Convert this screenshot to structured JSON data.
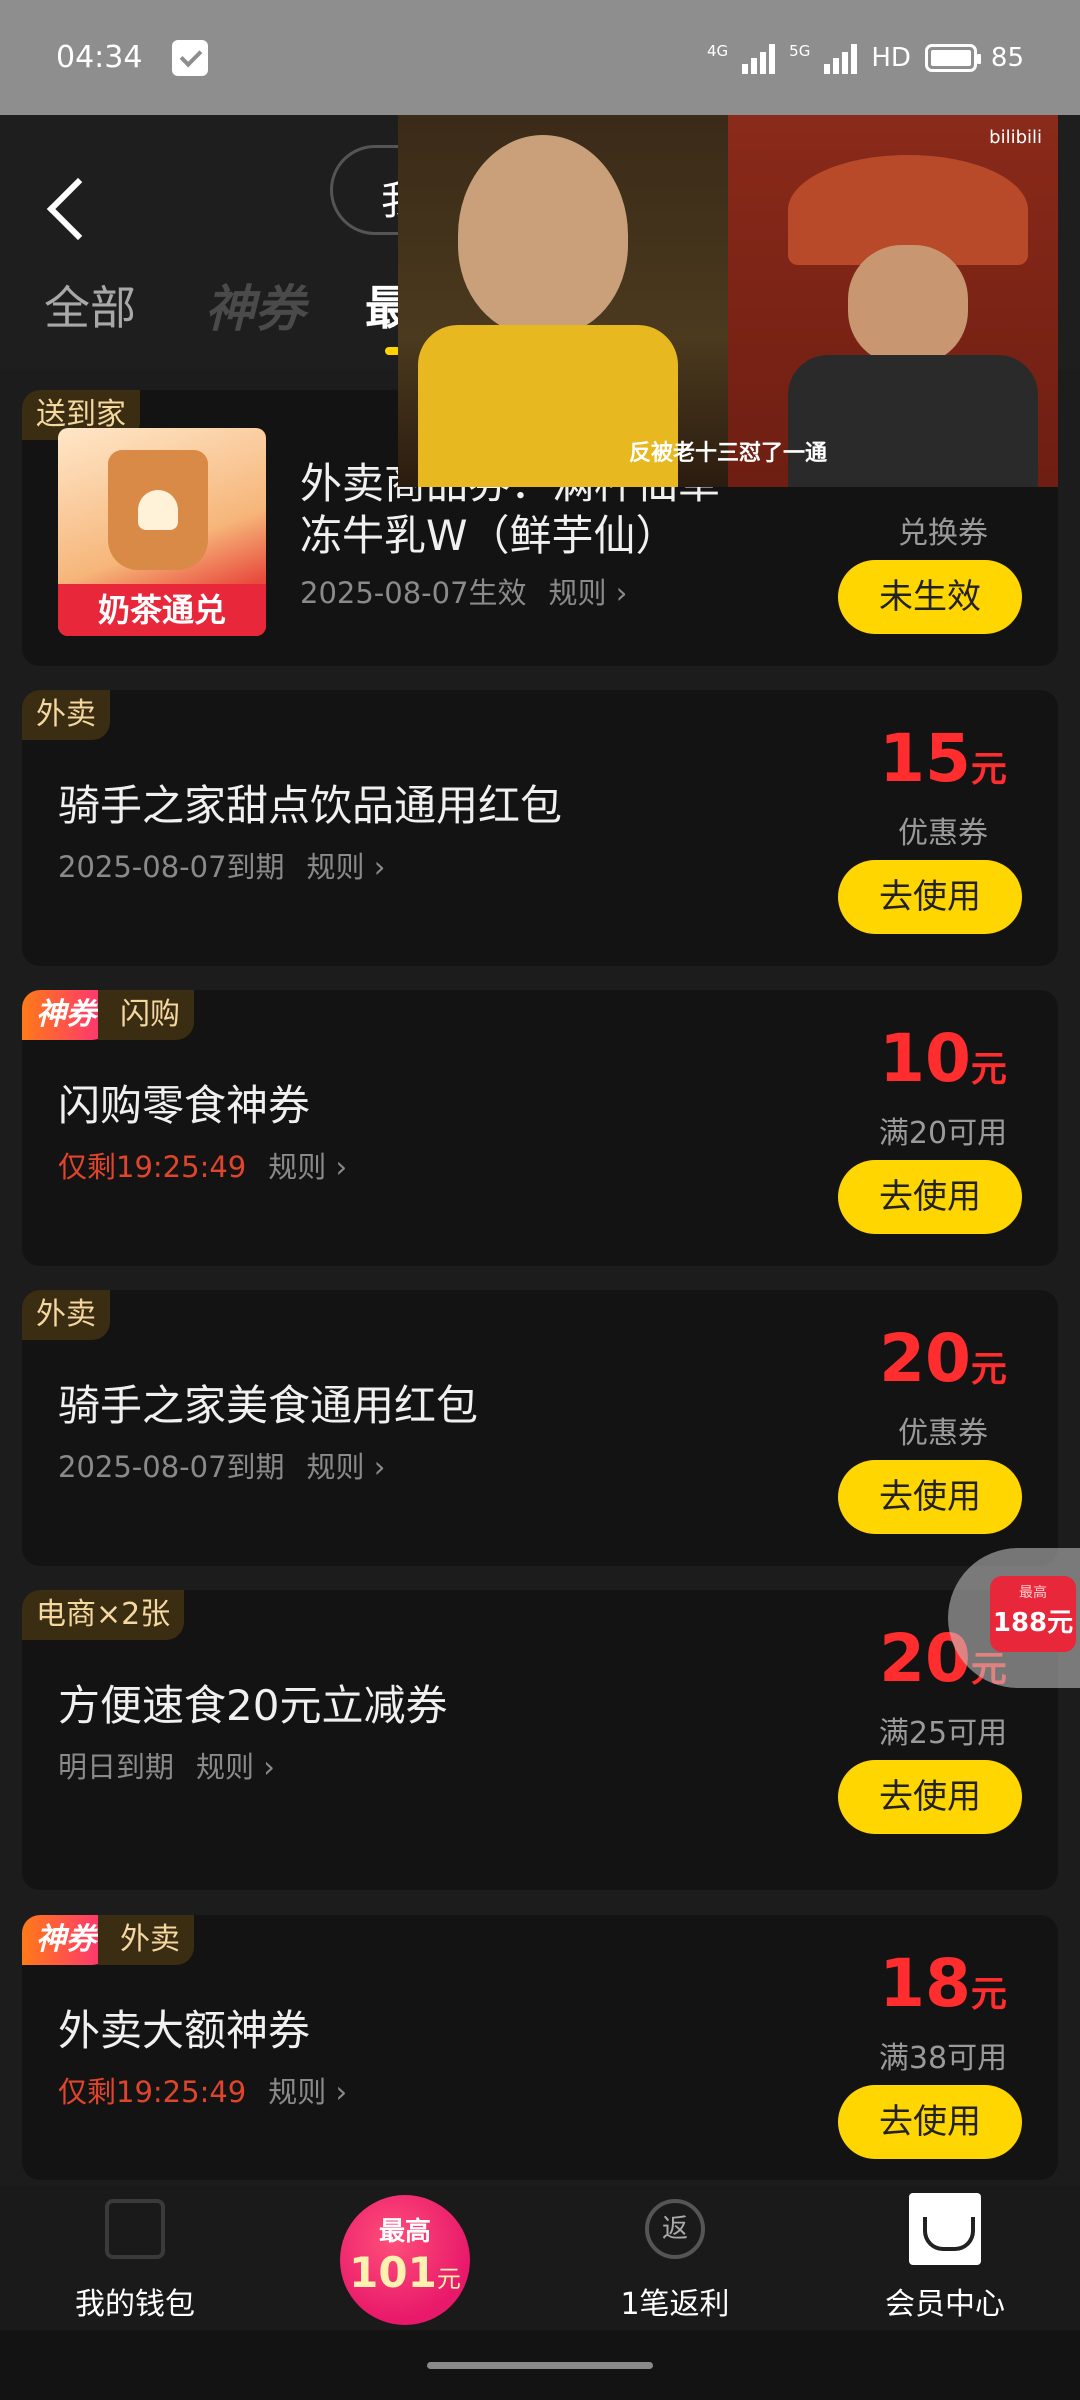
{
  "status_bar": {
    "time": "04:34",
    "net1": "4G",
    "net2": "5G",
    "hd": "HD",
    "battery": "85"
  },
  "header": {
    "pill_text": "我",
    "tabs": [
      "全部",
      "神券",
      "最"
    ]
  },
  "cards": [
    {
      "tags": [
        "送到家"
      ],
      "title_line1": "外卖商品券：满杯仙草",
      "title_line2": "冻牛乳W（鲜芋仙）",
      "date": "2025-08-07生效",
      "rule": "规则",
      "price_desc": "兑换券",
      "button": "未生效",
      "image_label": "奶茶通兑"
    },
    {
      "tags": [
        "外卖"
      ],
      "title": "骑手之家甜点饮品通用红包",
      "date": "2025-08-07到期",
      "rule": "规则",
      "amount": "15",
      "unit": "元",
      "price_desc": "优惠券",
      "button": "去使用"
    },
    {
      "tags": [
        "神券",
        "闪购"
      ],
      "title": "闪购零食神券",
      "countdown": "仅剩19:25:49",
      "rule": "规则",
      "amount": "10",
      "unit": "元",
      "price_desc": "满20可用",
      "button": "去使用"
    },
    {
      "tags": [
        "外卖"
      ],
      "title": "骑手之家美食通用红包",
      "date": "2025-08-07到期",
      "rule": "规则",
      "amount": "20",
      "unit": "元",
      "price_desc": "优惠券",
      "button": "去使用"
    },
    {
      "tags": [
        "电商×2张"
      ],
      "title": "方便速食20元立减券",
      "date": "明日到期",
      "rule": "规则",
      "amount": "20",
      "unit": "元",
      "price_desc": "满25可用",
      "button": "去使用"
    },
    {
      "tags": [
        "神券",
        "外卖"
      ],
      "title": "外卖大额神券",
      "countdown": "仅剩19:25:49",
      "rule": "规则",
      "amount": "18",
      "unit": "元",
      "price_desc": "满38可用",
      "button": "去使用"
    }
  ],
  "video": {
    "subtitle": "反被老十三怼了一通",
    "watermark": "bilibili"
  },
  "float_badge": {
    "small": "最高",
    "big": "188元"
  },
  "bottom_nav": {
    "wallet": "我的钱包",
    "center_top": "最高",
    "center_amount": "101",
    "center_unit": "元",
    "rebate_icon": "返",
    "rebate": "1笔返利",
    "vip": "会员中心"
  },
  "colors": {
    "accent_yellow": "#ffd600",
    "price_red": "#ff2d2d",
    "countdown_red": "#e0452c",
    "tag_brown": "#3a2d12"
  }
}
